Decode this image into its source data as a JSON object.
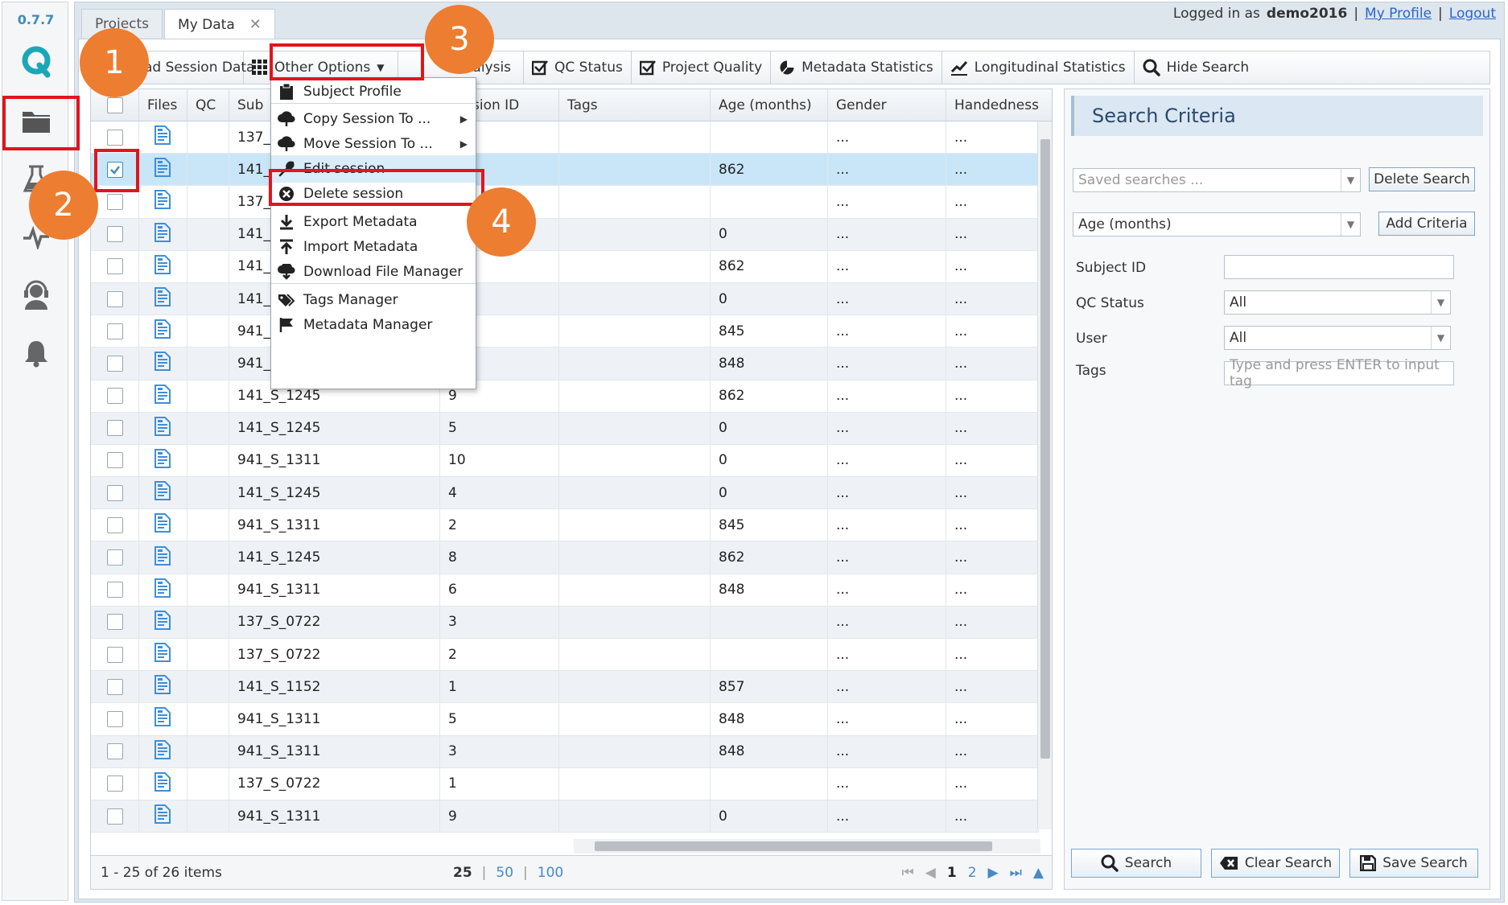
{
  "app": {
    "version": "0.7.7",
    "brand_color": "#1aa7b8",
    "accent_color": "#3c8dbc",
    "annotation_red": "#e3141c",
    "annotation_orange": "#ed7d31"
  },
  "sidebar": {
    "items": [
      {
        "icon": "folder-icon"
      },
      {
        "icon": "flask-icon"
      },
      {
        "icon": "activity-icon"
      },
      {
        "icon": "support-agent-icon"
      },
      {
        "icon": "bell-icon"
      }
    ]
  },
  "tabs": [
    {
      "label": "Projects"
    },
    {
      "label": "My Data"
    }
  ],
  "header": {
    "logged_in_as": "Logged in as",
    "username": "demo2016",
    "profile_link": "My Profile",
    "logout_link": "Logout",
    "separator": "|"
  },
  "toolbar": {
    "upload": "ad Session Data",
    "other_options": "Other Options",
    "analysis": "Analysis",
    "qc_status": "QC Status",
    "project_quality": "Project Quality",
    "metadata_statistics": "Metadata Statistics",
    "longitudinal_statistics": "Longitudinal Statistics",
    "hide_search": "Hide Search"
  },
  "grid": {
    "headers": {
      "files": "Files",
      "qc": "QC",
      "subject": "Sub",
      "session": "sion ID",
      "tags": "Tags",
      "age": "Age (months)",
      "gender": "Gender",
      "handedness": "Handedness"
    },
    "rows": [
      {
        "subject": "137_",
        "session": "",
        "age": "",
        "gender": "...",
        "hand": "...",
        "checked": false
      },
      {
        "subject": "141_",
        "session": "",
        "age": "862",
        "gender": "...",
        "hand": "...",
        "checked": true
      },
      {
        "subject": "137_",
        "session": "",
        "age": "",
        "gender": "...",
        "hand": "...",
        "checked": false
      },
      {
        "subject": "141_",
        "session": "",
        "age": "0",
        "gender": "...",
        "hand": "...",
        "checked": false
      },
      {
        "subject": "141_",
        "session": "",
        "age": "862",
        "gender": "...",
        "hand": "...",
        "checked": false
      },
      {
        "subject": "141_",
        "session": "",
        "age": "0",
        "gender": "...",
        "hand": "...",
        "checked": false
      },
      {
        "subject": "941_",
        "session": "",
        "age": "845",
        "gender": "...",
        "hand": "...",
        "checked": false
      },
      {
        "subject": "941_",
        "session": "",
        "age": "848",
        "gender": "...",
        "hand": "...",
        "checked": false
      },
      {
        "subject": "141_S_1245",
        "session": "9",
        "age": "862",
        "gender": "...",
        "hand": "...",
        "checked": false
      },
      {
        "subject": "141_S_1245",
        "session": "5",
        "age": "0",
        "gender": "...",
        "hand": "...",
        "checked": false
      },
      {
        "subject": "941_S_1311",
        "session": "10",
        "age": "0",
        "gender": "...",
        "hand": "...",
        "checked": false
      },
      {
        "subject": "141_S_1245",
        "session": "4",
        "age": "0",
        "gender": "...",
        "hand": "...",
        "checked": false
      },
      {
        "subject": "941_S_1311",
        "session": "2",
        "age": "845",
        "gender": "...",
        "hand": "...",
        "checked": false
      },
      {
        "subject": "141_S_1245",
        "session": "8",
        "age": "862",
        "gender": "...",
        "hand": "...",
        "checked": false
      },
      {
        "subject": "941_S_1311",
        "session": "6",
        "age": "848",
        "gender": "...",
        "hand": "...",
        "checked": false
      },
      {
        "subject": "137_S_0722",
        "session": "3",
        "age": "",
        "gender": "...",
        "hand": "...",
        "checked": false
      },
      {
        "subject": "137_S_0722",
        "session": "2",
        "age": "",
        "gender": "...",
        "hand": "...",
        "checked": false
      },
      {
        "subject": "141_S_1152",
        "session": "1",
        "age": "857",
        "gender": "...",
        "hand": "...",
        "checked": false
      },
      {
        "subject": "941_S_1311",
        "session": "5",
        "age": "848",
        "gender": "...",
        "hand": "...",
        "checked": false
      },
      {
        "subject": "941_S_1311",
        "session": "3",
        "age": "848",
        "gender": "...",
        "hand": "...",
        "checked": false
      },
      {
        "subject": "137_S_0722",
        "session": "1",
        "age": "",
        "gender": "...",
        "hand": "...",
        "checked": false
      },
      {
        "subject": "941_S_1311",
        "session": "9",
        "age": "0",
        "gender": "...",
        "hand": "...",
        "checked": false
      }
    ],
    "pager": {
      "items_text": "1 - 25 of 26 items",
      "size_25": "25",
      "size_50": "50",
      "size_100": "100",
      "page_1": "1",
      "page_2": "2"
    }
  },
  "menu": {
    "items": [
      {
        "label": "Subject Profile",
        "icon": "clipboard-icon"
      },
      {
        "label": "Copy Session To ...",
        "icon": "cloud-upload-icon",
        "submenu": true
      },
      {
        "label": "Move Session To ...",
        "icon": "cloud-upload-icon",
        "submenu": true
      },
      {
        "label": "Edit session",
        "icon": "wrench-icon"
      },
      {
        "label": "Delete session",
        "icon": "close-circle-icon"
      },
      {
        "label": "Export Metadata",
        "icon": "download-icon"
      },
      {
        "label": "Import Metadata",
        "icon": "upload-icon"
      },
      {
        "label": "Download File Manager",
        "icon": "cloud-download-icon"
      },
      {
        "label": "Tags Manager",
        "icon": "tags-icon"
      },
      {
        "label": "Metadata Manager",
        "icon": "flag-icon"
      }
    ]
  },
  "search": {
    "title": "Search Criteria",
    "saved_placeholder": "Saved searches ...",
    "delete_search": "Delete Search",
    "criteria_value": "Age (months)",
    "add_criteria": "Add Criteria",
    "subject_id_label": "Subject ID",
    "qc_status_label": "QC Status",
    "qc_status_value": "All",
    "user_label": "User",
    "user_value": "All",
    "tags_label": "Tags",
    "tags_placeholder": "Type and press ENTER to input tag",
    "search_btn": "Search",
    "clear_btn": "Clear Search",
    "save_btn": "Save Search"
  },
  "annotations": {
    "step1": "1",
    "step2": "2",
    "step3": "3",
    "step4": "4"
  }
}
